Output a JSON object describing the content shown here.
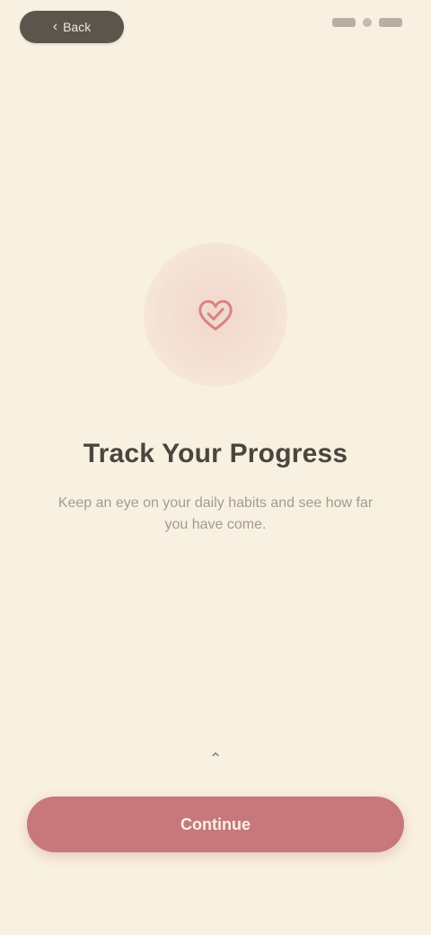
{
  "header": {
    "back_label": "Back",
    "back_icon": "chevron-left-icon"
  },
  "hero": {
    "icon": "heart-check-icon",
    "accent_color": "#d7857f"
  },
  "content": {
    "title": "Track Your Progress",
    "subtitle": "Keep an eye on your daily habits and see how far you have come."
  },
  "hint": {
    "icon": "chevron-up-icon"
  },
  "cta": {
    "label": "Continue",
    "color": "#c6787a"
  }
}
